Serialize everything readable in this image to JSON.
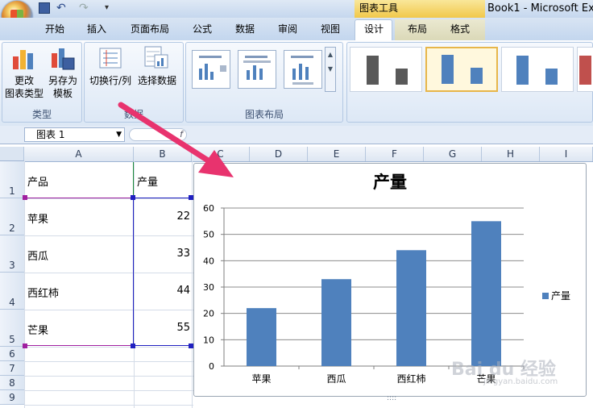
{
  "window": {
    "title": "Book1 - Microsoft Ex",
    "context_tools_label": "图表工具"
  },
  "tabs": [
    {
      "label": "开始"
    },
    {
      "label": "插入"
    },
    {
      "label": "页面布局"
    },
    {
      "label": "公式"
    },
    {
      "label": "数据"
    },
    {
      "label": "审阅"
    },
    {
      "label": "视图"
    },
    {
      "label": "设计",
      "active": true
    },
    {
      "label": "布局"
    },
    {
      "label": "格式"
    }
  ],
  "ribbon": {
    "type_group": {
      "label": "类型",
      "change_type_label": "更改\n图表类型",
      "save_template_label": "另存为\n模板"
    },
    "data_group": {
      "label": "数据",
      "switch_row_col_label": "切换行/列",
      "select_data_label": "选择数据"
    },
    "layout_group": {
      "label": "图表布局"
    }
  },
  "formula_bar": {
    "name_box": "图表 1",
    "fx_label": "f"
  },
  "sheet": {
    "columns": [
      "A",
      "B",
      "C",
      "D",
      "E",
      "F",
      "G",
      "H",
      "I"
    ],
    "rows": [
      "1",
      "2",
      "3",
      "4",
      "5",
      "6",
      "7",
      "8",
      "9"
    ],
    "header_a": "产品",
    "header_b": "产量",
    "data": [
      {
        "product": "苹果",
        "value": "22"
      },
      {
        "product": "西瓜",
        "value": "33"
      },
      {
        "product": "西红柿",
        "value": "44"
      },
      {
        "product": "芒果",
        "value": "55"
      }
    ]
  },
  "chart_data": {
    "type": "bar",
    "title": "产量",
    "categories": [
      "苹果",
      "西瓜",
      "西红柿",
      "芒果"
    ],
    "series": [
      {
        "name": "产量",
        "values": [
          22,
          33,
          44,
          55
        ],
        "color": "#4f81bd"
      }
    ],
    "ylim": [
      0,
      60
    ],
    "yticks": [
      0,
      10,
      20,
      30,
      40,
      50,
      60
    ],
    "grid": true,
    "legend": "right"
  },
  "watermark": {
    "text": "Bai du 经验",
    "sub": "jingyan.baidu.com"
  },
  "colors": {
    "accent_arrow": "#e8336e",
    "bar": "#4f81bd"
  }
}
